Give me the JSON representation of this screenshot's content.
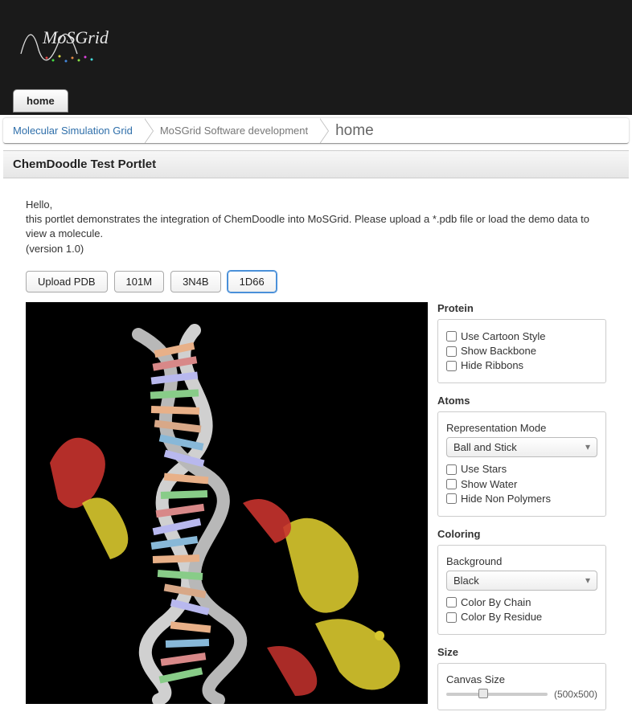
{
  "logo_text": "MoSGrid",
  "nav": {
    "home": "home"
  },
  "breadcrumb": {
    "root": "Molecular Simulation Grid",
    "mid": "MoSGrid Software development",
    "leaf": "home"
  },
  "portlet": {
    "title": "ChemDoodle Test Portlet",
    "greeting": "Hello,",
    "description": "this portlet demonstrates the integration of ChemDoodle into MoSGrid. Please upload a *.pdb file or load the demo data to view a molecule.",
    "version": "(version 1.0)"
  },
  "buttons": {
    "upload": "Upload PDB",
    "b101m": "101M",
    "b3n4b": "3N4B",
    "b1d66": "1D66"
  },
  "panels": {
    "protein": {
      "title": "Protein",
      "use_cartoon": "Use Cartoon Style",
      "show_backbone": "Show Backbone",
      "hide_ribbons": "Hide Ribbons"
    },
    "atoms": {
      "title": "Atoms",
      "rep_mode_label": "Representation Mode",
      "rep_mode_value": "Ball and Stick",
      "use_stars": "Use Stars",
      "show_water": "Show Water",
      "hide_non_polymers": "Hide Non Polymers"
    },
    "coloring": {
      "title": "Coloring",
      "background_label": "Background",
      "background_value": "Black",
      "by_chain": "Color By Chain",
      "by_residue": "Color By Residue"
    },
    "size": {
      "title": "Size",
      "canvas_label": "Canvas Size",
      "canvas_value": "(500x500)"
    }
  }
}
